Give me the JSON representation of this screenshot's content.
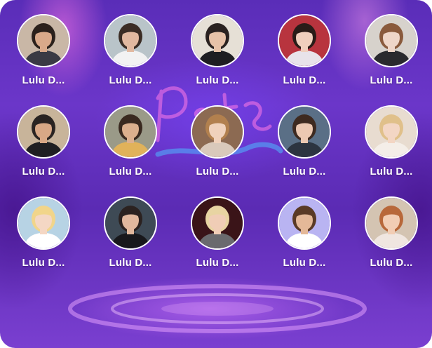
{
  "grid": {
    "cards": [
      {
        "name": "Lulu D...",
        "avatar": "avatar-photo",
        "bg": "#c9b7a6",
        "skin": "#d9a98a",
        "hair": "#2b211c",
        "shirt": "#3a3a44"
      },
      {
        "name": "Lulu D...",
        "avatar": "avatar-photo",
        "bg": "#b9c4c9",
        "skin": "#e2b9a0",
        "hair": "#3b2d25",
        "shirt": "#f2f2f2"
      },
      {
        "name": "Lulu D...",
        "avatar": "avatar-photo",
        "bg": "#e6e0d6",
        "skin": "#e7c2a8",
        "hair": "#2a2220",
        "shirt": "#1e1e22"
      },
      {
        "name": "Lulu D...",
        "avatar": "avatar-photo",
        "bg": "#b8343e",
        "skin": "#f0cfbd",
        "hair": "#2a1c18",
        "shirt": "#e8e3ea"
      },
      {
        "name": "Lulu D...",
        "avatar": "avatar-photo",
        "bg": "#d7d2cc",
        "skin": "#efd6c8",
        "hair": "#8a5a3c",
        "shirt": "#2a2a2e"
      },
      {
        "name": "Lulu D...",
        "avatar": "avatar-photo",
        "bg": "#c8b49a",
        "skin": "#d8a886",
        "hair": "#2a2422",
        "shirt": "#1f1f22"
      },
      {
        "name": "Lulu D...",
        "avatar": "avatar-photo",
        "bg": "#9a9a88",
        "skin": "#dcb08e",
        "hair": "#3a2a20",
        "shirt": "#e0b25a"
      },
      {
        "name": "Lulu D...",
        "avatar": "avatar-photo",
        "bg": "#8c6a52",
        "skin": "#f0d2bc",
        "hair": "#b2804e",
        "shirt": "#d9c9bb"
      },
      {
        "name": "Lulu D...",
        "avatar": "avatar-photo",
        "bg": "#5a6f86",
        "skin": "#ecc8b2",
        "hair": "#3e2a20",
        "shirt": "#2c3440"
      },
      {
        "name": "Lulu D...",
        "avatar": "avatar-photo",
        "bg": "#e8dcd0",
        "skin": "#f3d6c4",
        "hair": "#e0c08a",
        "shirt": "#f4eee8"
      },
      {
        "name": "Lulu D...",
        "avatar": "avatar-photo",
        "bg": "#b7d3e4",
        "skin": "#f4d7c4",
        "hair": "#f1d58a",
        "shirt": "#ffffff"
      },
      {
        "name": "Lulu D...",
        "avatar": "avatar-photo",
        "bg": "#3e4a55",
        "skin": "#e1b89e",
        "hair": "#2b2220",
        "shirt": "#18181c"
      },
      {
        "name": "Lulu D...",
        "avatar": "avatar-photo",
        "bg": "#3a1418",
        "skin": "#f0cdb6",
        "hair": "#e8d4a2",
        "shirt": "#6a6a6e"
      },
      {
        "name": "Lulu D...",
        "avatar": "avatar-photo",
        "bg": "#b9b4f2",
        "skin": "#e4b898",
        "hair": "#5a3a26",
        "shirt": "#ffffff"
      },
      {
        "name": "Lulu D...",
        "avatar": "avatar-photo",
        "bg": "#d4c4b2",
        "skin": "#f2cdb4",
        "hair": "#b8683a",
        "shirt": "#f0e6e0"
      }
    ]
  }
}
